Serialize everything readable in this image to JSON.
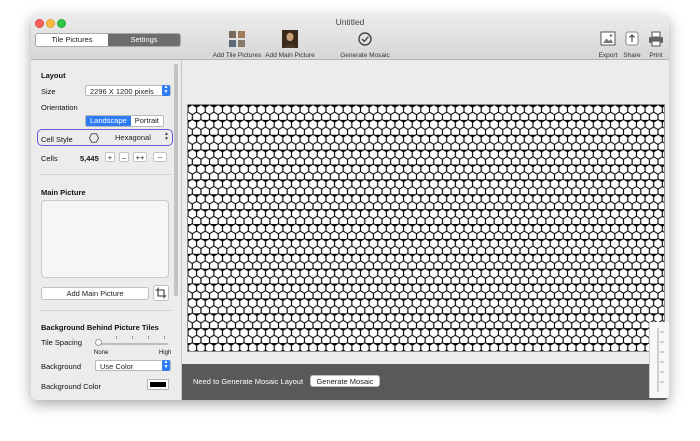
{
  "window": {
    "title": "Untitled"
  },
  "tabs": [
    {
      "label": "Tile Pictures",
      "active": false
    },
    {
      "label": "Settings",
      "active": true
    }
  ],
  "toolbar": {
    "add_tiles": "Add Tile Pictures",
    "add_main": "Add Main Picture",
    "generate": "Generate Mosaic",
    "export": "Export",
    "share": "Share",
    "print": "Print"
  },
  "layout": {
    "heading": "Layout",
    "size_label": "Size",
    "size_value": "2296 X 1200 pixels",
    "orientation_label": "Orientation",
    "orientation_options": [
      "Landscape",
      "Portrait"
    ],
    "orientation_selected": "Landscape",
    "cell_style_label": "Cell Style",
    "cell_style_value": "Hexagonal",
    "cells_label": "Cells",
    "cells_value": "5,445",
    "cells_buttons": [
      "+",
      "–",
      "++",
      "--"
    ]
  },
  "main_picture": {
    "heading": "Main Picture",
    "add_button": "Add Main Picture"
  },
  "background": {
    "heading": "Background Behind Picture Tiles",
    "tile_spacing_label": "Tile Spacing",
    "slider_min_label": "None",
    "slider_max_label": "High",
    "tile_spacing_value": 0,
    "background_label": "Background",
    "background_value": "Use Color",
    "background_color_label": "Background Color",
    "background_color": "#000000"
  },
  "status": {
    "message": "Need to Generate Mosaic Layout",
    "button": "Generate Mosaic"
  },
  "colors": {
    "accent": "#2d7cf6",
    "highlight": "#6a56d9",
    "bottom_bar": "#595959"
  }
}
